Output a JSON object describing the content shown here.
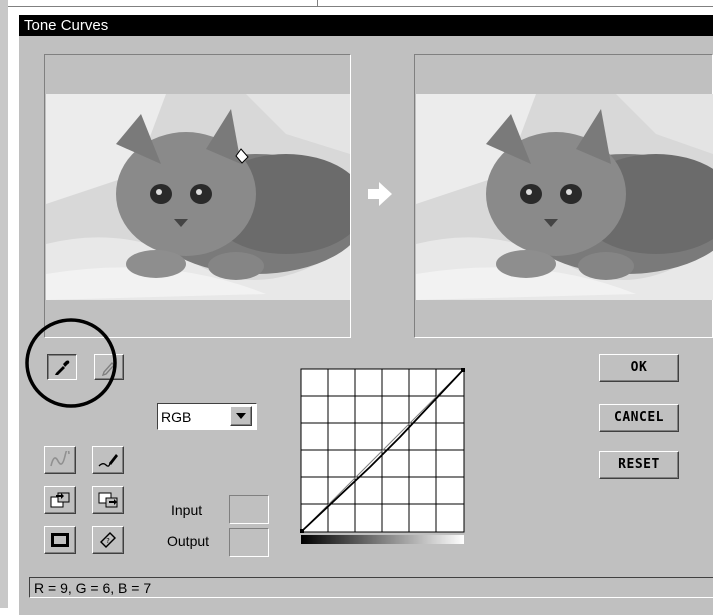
{
  "window": {
    "title": "Tone Curves"
  },
  "toolbar": {
    "eyedropper_icon": "eyedropper-icon",
    "pencil_icon": "pencil-icon"
  },
  "channel": {
    "selected": "RGB"
  },
  "tools": {
    "smooth_curve_icon": "smooth-curve-icon",
    "freehand_curve_icon": "freehand-curve-icon",
    "load_icon": "load-icon",
    "save_icon": "save-icon",
    "reset_view_icon": "frame-icon",
    "help_icon": "help-book-icon"
  },
  "readout": {
    "input_label": "Input",
    "output_label": "Output",
    "input_value": "",
    "output_value": ""
  },
  "buttons": {
    "ok": "OK",
    "cancel": "CANCEL",
    "reset": "RESET"
  },
  "status": {
    "text": "R = 9,  G = 6,  B = 7"
  },
  "colors": {
    "title_bar": "#000000",
    "face": "#c0c0c0"
  }
}
